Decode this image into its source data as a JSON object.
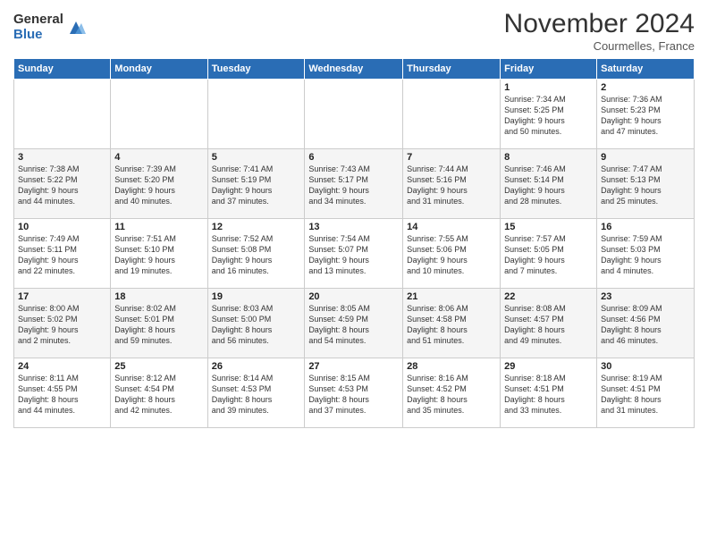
{
  "logo": {
    "general": "General",
    "blue": "Blue"
  },
  "header": {
    "month": "November 2024",
    "location": "Courmelles, France"
  },
  "weekdays": [
    "Sunday",
    "Monday",
    "Tuesday",
    "Wednesday",
    "Thursday",
    "Friday",
    "Saturday"
  ],
  "weeks": [
    [
      {
        "day": "",
        "info": ""
      },
      {
        "day": "",
        "info": ""
      },
      {
        "day": "",
        "info": ""
      },
      {
        "day": "",
        "info": ""
      },
      {
        "day": "",
        "info": ""
      },
      {
        "day": "1",
        "info": "Sunrise: 7:34 AM\nSunset: 5:25 PM\nDaylight: 9 hours\nand 50 minutes."
      },
      {
        "day": "2",
        "info": "Sunrise: 7:36 AM\nSunset: 5:23 PM\nDaylight: 9 hours\nand 47 minutes."
      }
    ],
    [
      {
        "day": "3",
        "info": "Sunrise: 7:38 AM\nSunset: 5:22 PM\nDaylight: 9 hours\nand 44 minutes."
      },
      {
        "day": "4",
        "info": "Sunrise: 7:39 AM\nSunset: 5:20 PM\nDaylight: 9 hours\nand 40 minutes."
      },
      {
        "day": "5",
        "info": "Sunrise: 7:41 AM\nSunset: 5:19 PM\nDaylight: 9 hours\nand 37 minutes."
      },
      {
        "day": "6",
        "info": "Sunrise: 7:43 AM\nSunset: 5:17 PM\nDaylight: 9 hours\nand 34 minutes."
      },
      {
        "day": "7",
        "info": "Sunrise: 7:44 AM\nSunset: 5:16 PM\nDaylight: 9 hours\nand 31 minutes."
      },
      {
        "day": "8",
        "info": "Sunrise: 7:46 AM\nSunset: 5:14 PM\nDaylight: 9 hours\nand 28 minutes."
      },
      {
        "day": "9",
        "info": "Sunrise: 7:47 AM\nSunset: 5:13 PM\nDaylight: 9 hours\nand 25 minutes."
      }
    ],
    [
      {
        "day": "10",
        "info": "Sunrise: 7:49 AM\nSunset: 5:11 PM\nDaylight: 9 hours\nand 22 minutes."
      },
      {
        "day": "11",
        "info": "Sunrise: 7:51 AM\nSunset: 5:10 PM\nDaylight: 9 hours\nand 19 minutes."
      },
      {
        "day": "12",
        "info": "Sunrise: 7:52 AM\nSunset: 5:08 PM\nDaylight: 9 hours\nand 16 minutes."
      },
      {
        "day": "13",
        "info": "Sunrise: 7:54 AM\nSunset: 5:07 PM\nDaylight: 9 hours\nand 13 minutes."
      },
      {
        "day": "14",
        "info": "Sunrise: 7:55 AM\nSunset: 5:06 PM\nDaylight: 9 hours\nand 10 minutes."
      },
      {
        "day": "15",
        "info": "Sunrise: 7:57 AM\nSunset: 5:05 PM\nDaylight: 9 hours\nand 7 minutes."
      },
      {
        "day": "16",
        "info": "Sunrise: 7:59 AM\nSunset: 5:03 PM\nDaylight: 9 hours\nand 4 minutes."
      }
    ],
    [
      {
        "day": "17",
        "info": "Sunrise: 8:00 AM\nSunset: 5:02 PM\nDaylight: 9 hours\nand 2 minutes."
      },
      {
        "day": "18",
        "info": "Sunrise: 8:02 AM\nSunset: 5:01 PM\nDaylight: 8 hours\nand 59 minutes."
      },
      {
        "day": "19",
        "info": "Sunrise: 8:03 AM\nSunset: 5:00 PM\nDaylight: 8 hours\nand 56 minutes."
      },
      {
        "day": "20",
        "info": "Sunrise: 8:05 AM\nSunset: 4:59 PM\nDaylight: 8 hours\nand 54 minutes."
      },
      {
        "day": "21",
        "info": "Sunrise: 8:06 AM\nSunset: 4:58 PM\nDaylight: 8 hours\nand 51 minutes."
      },
      {
        "day": "22",
        "info": "Sunrise: 8:08 AM\nSunset: 4:57 PM\nDaylight: 8 hours\nand 49 minutes."
      },
      {
        "day": "23",
        "info": "Sunrise: 8:09 AM\nSunset: 4:56 PM\nDaylight: 8 hours\nand 46 minutes."
      }
    ],
    [
      {
        "day": "24",
        "info": "Sunrise: 8:11 AM\nSunset: 4:55 PM\nDaylight: 8 hours\nand 44 minutes."
      },
      {
        "day": "25",
        "info": "Sunrise: 8:12 AM\nSunset: 4:54 PM\nDaylight: 8 hours\nand 42 minutes."
      },
      {
        "day": "26",
        "info": "Sunrise: 8:14 AM\nSunset: 4:53 PM\nDaylight: 8 hours\nand 39 minutes."
      },
      {
        "day": "27",
        "info": "Sunrise: 8:15 AM\nSunset: 4:53 PM\nDaylight: 8 hours\nand 37 minutes."
      },
      {
        "day": "28",
        "info": "Sunrise: 8:16 AM\nSunset: 4:52 PM\nDaylight: 8 hours\nand 35 minutes."
      },
      {
        "day": "29",
        "info": "Sunrise: 8:18 AM\nSunset: 4:51 PM\nDaylight: 8 hours\nand 33 minutes."
      },
      {
        "day": "30",
        "info": "Sunrise: 8:19 AM\nSunset: 4:51 PM\nDaylight: 8 hours\nand 31 minutes."
      }
    ]
  ]
}
